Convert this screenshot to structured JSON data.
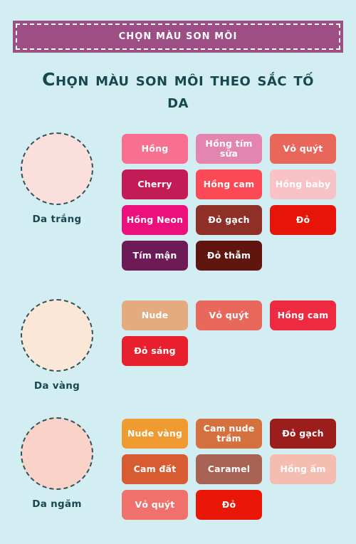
{
  "background_color": "#d3eef3",
  "banner": {
    "text": "CHỌN MÀU SON MÔI",
    "fill_color": "#9d4e85",
    "border_color": "#ffffff",
    "text_color": "#ffffff"
  },
  "page_title": {
    "line1": "Chọn màu son môi theo sắc",
    "line2": "tố da",
    "full": "Chọn màu son môi theo sắc tố da",
    "color": "#17484f"
  },
  "sections": [
    {
      "skin_label": "Da trắng",
      "skin_color": "#fbdfdc",
      "circle_border_color": "#2a5661",
      "label_color": "#17484f",
      "shades": [
        {
          "name": "Hồng",
          "color": "#f8708f",
          "text_color": "#ffffff"
        },
        {
          "name": "Hồng tím sữa",
          "color": "#e485b0",
          "text_color": "#ffffff"
        },
        {
          "name": "Vỏ quýt",
          "color": "#e9665b",
          "text_color": "#ffffff"
        },
        {
          "name": "Cherry",
          "color": "#c21b55",
          "text_color": "#ffffff"
        },
        {
          "name": "Hồng cam",
          "color": "#fb4a55",
          "text_color": "#ffffff"
        },
        {
          "name": "Hồng baby",
          "color": "#f8c2c6",
          "text_color": "#ffffff"
        },
        {
          "name": "Hồng Neon",
          "color": "#ed0f7c",
          "text_color": "#ffffff"
        },
        {
          "name": "Đỏ gạch",
          "color": "#8e3027",
          "text_color": "#ffffff"
        },
        {
          "name": "Đỏ",
          "color": "#e71408",
          "text_color": "#ffffff"
        },
        {
          "name": "Tím mận",
          "color": "#6d1a56",
          "text_color": "#ffffff"
        },
        {
          "name": "Đỏ thẫm",
          "color": "#61150f",
          "text_color": "#ffffff"
        }
      ]
    },
    {
      "skin_label": "Da vàng",
      "skin_color": "#fbe7d7",
      "circle_border_color": "#2a5661",
      "label_color": "#17484f",
      "shades": [
        {
          "name": "Nude",
          "color": "#e3ab7f",
          "text_color": "#ffffff"
        },
        {
          "name": "Vỏ quýt",
          "color": "#e9685c",
          "text_color": "#ffffff"
        },
        {
          "name": "Hồng cam",
          "color": "#ee2a41",
          "text_color": "#ffffff"
        },
        {
          "name": "Đỏ sáng",
          "color": "#e81f2d",
          "text_color": "#ffffff"
        }
      ]
    },
    {
      "skin_label": "Da ngăm",
      "skin_color": "#f9d3c8",
      "circle_border_color": "#2a5661",
      "label_color": "#17484f",
      "shades": [
        {
          "name": "Nude vàng",
          "color": "#f09b32",
          "text_color": "#ffffff"
        },
        {
          "name": "Cam nude trầm",
          "color": "#d4713f",
          "text_color": "#ffffff"
        },
        {
          "name": "Đỏ gạch",
          "color": "#9c1e1c",
          "text_color": "#ffffff"
        },
        {
          "name": "Cam đất",
          "color": "#d85c32",
          "text_color": "#ffffff"
        },
        {
          "name": "Caramel",
          "color": "#a86355",
          "text_color": "#ffffff"
        },
        {
          "name": "Hồng ấm",
          "color": "#f5bdb0",
          "text_color": "#ffffff"
        },
        {
          "name": "Vỏ quýt",
          "color": "#f0716b",
          "text_color": "#ffffff"
        },
        {
          "name": "Đỏ",
          "color": "#ea1709",
          "text_color": "#ffffff"
        }
      ]
    }
  ]
}
